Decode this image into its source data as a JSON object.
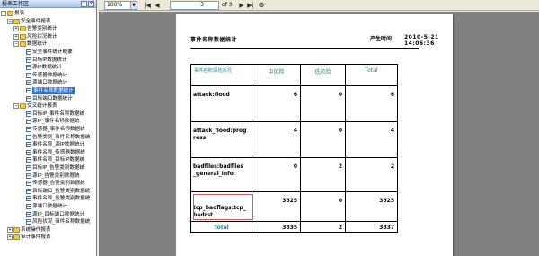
{
  "panel": {
    "title": "报表工作区",
    "controls": [
      "‹",
      "×"
    ]
  },
  "tree": [
    {
      "label": "报表",
      "toggle": "−",
      "icon": "folder"
    },
    {
      "label": "安全事件报表",
      "toggle": "−",
      "icon": "folder"
    },
    {
      "label": "告警类别统计",
      "toggle": "+",
      "icon": "folder"
    },
    {
      "label": "风险状况统计",
      "toggle": "+",
      "icon": "folder"
    },
    {
      "label": "数据统计",
      "toggle": "−",
      "icon": "folder"
    },
    {
      "label": "安全事件统计概要",
      "toggle": "",
      "icon": "doc"
    },
    {
      "label": "目标IP数据统计",
      "toggle": "",
      "icon": "doc"
    },
    {
      "label": "源IP数据统计",
      "toggle": "",
      "icon": "doc"
    },
    {
      "label": "传感器数据统计",
      "toggle": "",
      "icon": "doc"
    },
    {
      "label": "源端口数据统计",
      "toggle": "",
      "icon": "doc"
    },
    {
      "label": "事件名称数据统计",
      "toggle": "",
      "icon": "doc"
    },
    {
      "label": "目标端口数据统计",
      "toggle": "",
      "icon": "doc"
    },
    {
      "label": "交叉统计报表",
      "toggle": "−",
      "icon": "folder"
    },
    {
      "label": "目标IP_事件名称数据统",
      "toggle": "",
      "icon": "doc"
    },
    {
      "label": "源IP_事件名称数据统",
      "toggle": "",
      "icon": "doc"
    },
    {
      "label": "传感器_事件名称数据统",
      "toggle": "",
      "icon": "doc"
    },
    {
      "label": "告警类别_事件名称数据统",
      "toggle": "",
      "icon": "doc"
    },
    {
      "label": "事件名称_源IP数据统计",
      "toggle": "",
      "icon": "doc"
    },
    {
      "label": "事件名称_传感器数据统",
      "toggle": "",
      "icon": "doc"
    },
    {
      "label": "事件名称_目标IP数据统",
      "toggle": "",
      "icon": "doc"
    },
    {
      "label": "目标IP_告警类别数据统",
      "toggle": "",
      "icon": "doc"
    },
    {
      "label": "源IP_告警类别数据统",
      "toggle": "",
      "icon": "doc"
    },
    {
      "label": "传感器_告警类别数据统",
      "toggle": "",
      "icon": "doc"
    },
    {
      "label": "目标端口_告警类别数据统",
      "toggle": "",
      "icon": "doc"
    },
    {
      "label": "事件名称_告警类别数据统",
      "toggle": "",
      "icon": "doc"
    },
    {
      "label": "源端口数据统计",
      "toggle": "",
      "icon": "doc"
    },
    {
      "label": "源IP_目标端口数据统计",
      "toggle": "",
      "icon": "doc"
    },
    {
      "label": "风险状况_事件名称数据统",
      "toggle": "",
      "icon": "doc"
    },
    {
      "label": "系统操作报表",
      "toggle": "+",
      "icon": "folder"
    },
    {
      "label": "审计事件报表",
      "toggle": "+",
      "icon": "folder"
    }
  ],
  "toolbar": {
    "zoom": "100%",
    "zoom_arrow": "▼",
    "first": "|◀",
    "prev": "◀",
    "next": "▶",
    "last": "▶|",
    "page": "3",
    "page_of": "of 3",
    "find_icon": "binoculars-icon",
    "find_glyph": "⊛"
  },
  "report": {
    "title": "事件名称数据统计",
    "gen_time_label": "产生时间：",
    "gen_time_value": "2010-5-21  14:06:36",
    "header": [
      "事件名称\\风险状况",
      "中风险",
      "低风险",
      "Total"
    ],
    "rows": [
      {
        "name": "attack:flood",
        "mid": "6",
        "low": "0",
        "total": "6"
      },
      {
        "name": "attack_flood:prog\nress",
        "mid": "4",
        "low": "0",
        "total": "4"
      },
      {
        "name": "badfiles:badfiles\n_general_info",
        "mid": "0",
        "low": "2",
        "total": "2"
      },
      {
        "name": "tcp_badflags:tcp_\nbadrst",
        "mid": "3825",
        "low": "0",
        "total": "3825"
      }
    ],
    "total_row": {
      "name": "Total",
      "mid": "3835",
      "low": "2",
      "total": "3837"
    }
  }
}
